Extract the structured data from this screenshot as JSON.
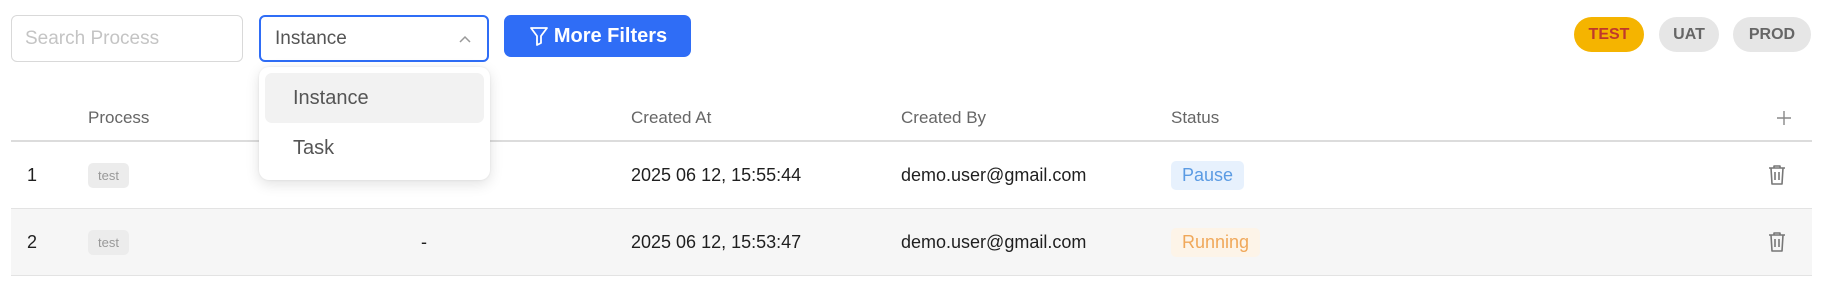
{
  "search": {
    "placeholder": "Search Process"
  },
  "type_select": {
    "value": "Instance",
    "options": [
      "Instance",
      "Task"
    ]
  },
  "more_filters": {
    "label": "More Filters"
  },
  "environments": [
    "TEST",
    "UAT",
    "PROD"
  ],
  "table": {
    "columns": [
      "Process",
      "Created At",
      "Created By",
      "Status"
    ],
    "rows": [
      {
        "index": "1",
        "process": "test",
        "extra": "",
        "created_at": "2025 06 12, 15:55:44",
        "created_by": "demo.user@gmail.com",
        "status": "Pause"
      },
      {
        "index": "2",
        "process": "test",
        "extra": "-",
        "created_at": "2025 06 12, 15:53:47",
        "created_by": "demo.user@gmail.com",
        "status": "Running"
      }
    ]
  },
  "colors": {
    "primary": "#2f6df6",
    "test_badge": "#f5b400",
    "pause": "#5b9be3",
    "running": "#f0a85a"
  }
}
